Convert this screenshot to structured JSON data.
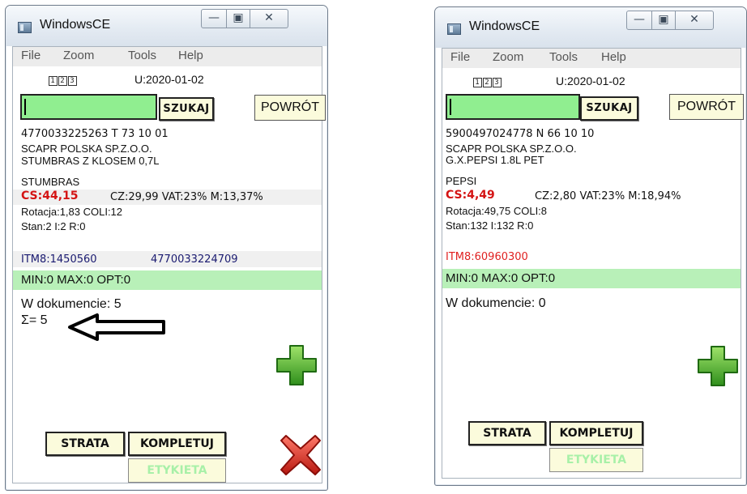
{
  "windows": [
    {
      "title": "WindowsCE",
      "controls": {
        "minimize": "—",
        "maximize": "▣",
        "close": "✕"
      },
      "menu": [
        "File",
        "Zoom",
        "Tools",
        "Help"
      ],
      "mode_icons": [
        "1",
        "2",
        "3"
      ],
      "date": "U:2020-01-02",
      "search": {
        "value": "",
        "button": "SZUKAJ"
      },
      "back_button": "POWRÓT",
      "product": {
        "barcode_line": "4770033225263   T   73 10 01",
        "supplier": "SCAPR POLSKA SP.Z.O.O.",
        "name": "STUMBRAS Z KLOSEM 0,7L",
        "brand": "STUMBRAS",
        "cs": "CS:44,15",
        "cz_vat_m": "CZ:29,99  VAT:23%  M:13,37%",
        "rotation_coli": "Rotacja:1,83   COLI:12",
        "stock": "Stan:2  I:2  R:0"
      },
      "itm": {
        "code": "ITM8:1450560",
        "ean": "4770033224709"
      },
      "minmax": "MIN:0 MAX:0 OPT:0",
      "in_document": "W dokumencie: 5",
      "sum": "Σ= 5",
      "buttons": {
        "strata": "STRATA",
        "kompletuj": "KOMPLETUJ",
        "etykieta": "ETYKIETA"
      }
    },
    {
      "title": "WindowsCE",
      "controls": {
        "minimize": "—",
        "maximize": "▣",
        "close": "✕"
      },
      "menu": [
        "File",
        "Zoom",
        "Tools",
        "Help"
      ],
      "mode_icons": [
        "1",
        "2",
        "3"
      ],
      "date": "U:2020-01-02",
      "search": {
        "value": "",
        "button": "SZUKAJ"
      },
      "back_button": "POWRÓT",
      "product": {
        "barcode_line": "5900497024778   N   66 10 10",
        "supplier": "SCAPR POLSKA SP.Z.O.O.",
        "name": "G.X.PEPSI 1.8L PET",
        "brand": "PEPSI",
        "cs": "CS:4,49",
        "cz_vat_m": "CZ:2,80  VAT:23%  M:18,94%",
        "rotation_coli": "Rotacja:49,75   COLI:8",
        "stock": "Stan:132  I:132  R:0"
      },
      "itm": {
        "code": "ITM8:60960300",
        "ean": ""
      },
      "minmax": "MIN:0 MAX:0 OPT:0",
      "in_document": "W dokumencie: 0",
      "buttons": {
        "strata": "STRATA",
        "kompletuj": "KOMPLETUJ",
        "etykieta": "ETYKIETA"
      }
    }
  ],
  "colors": {
    "search_field": "#90ee90",
    "minmax_bar": "#b8f0b8",
    "price_red": "#d41414",
    "button_face": "#fbfbdc",
    "disabled_text": "#a8f0a8"
  },
  "icons": {
    "add": "plus-icon",
    "cancel": "x-icon",
    "pointer": "arrow-left-icon"
  }
}
